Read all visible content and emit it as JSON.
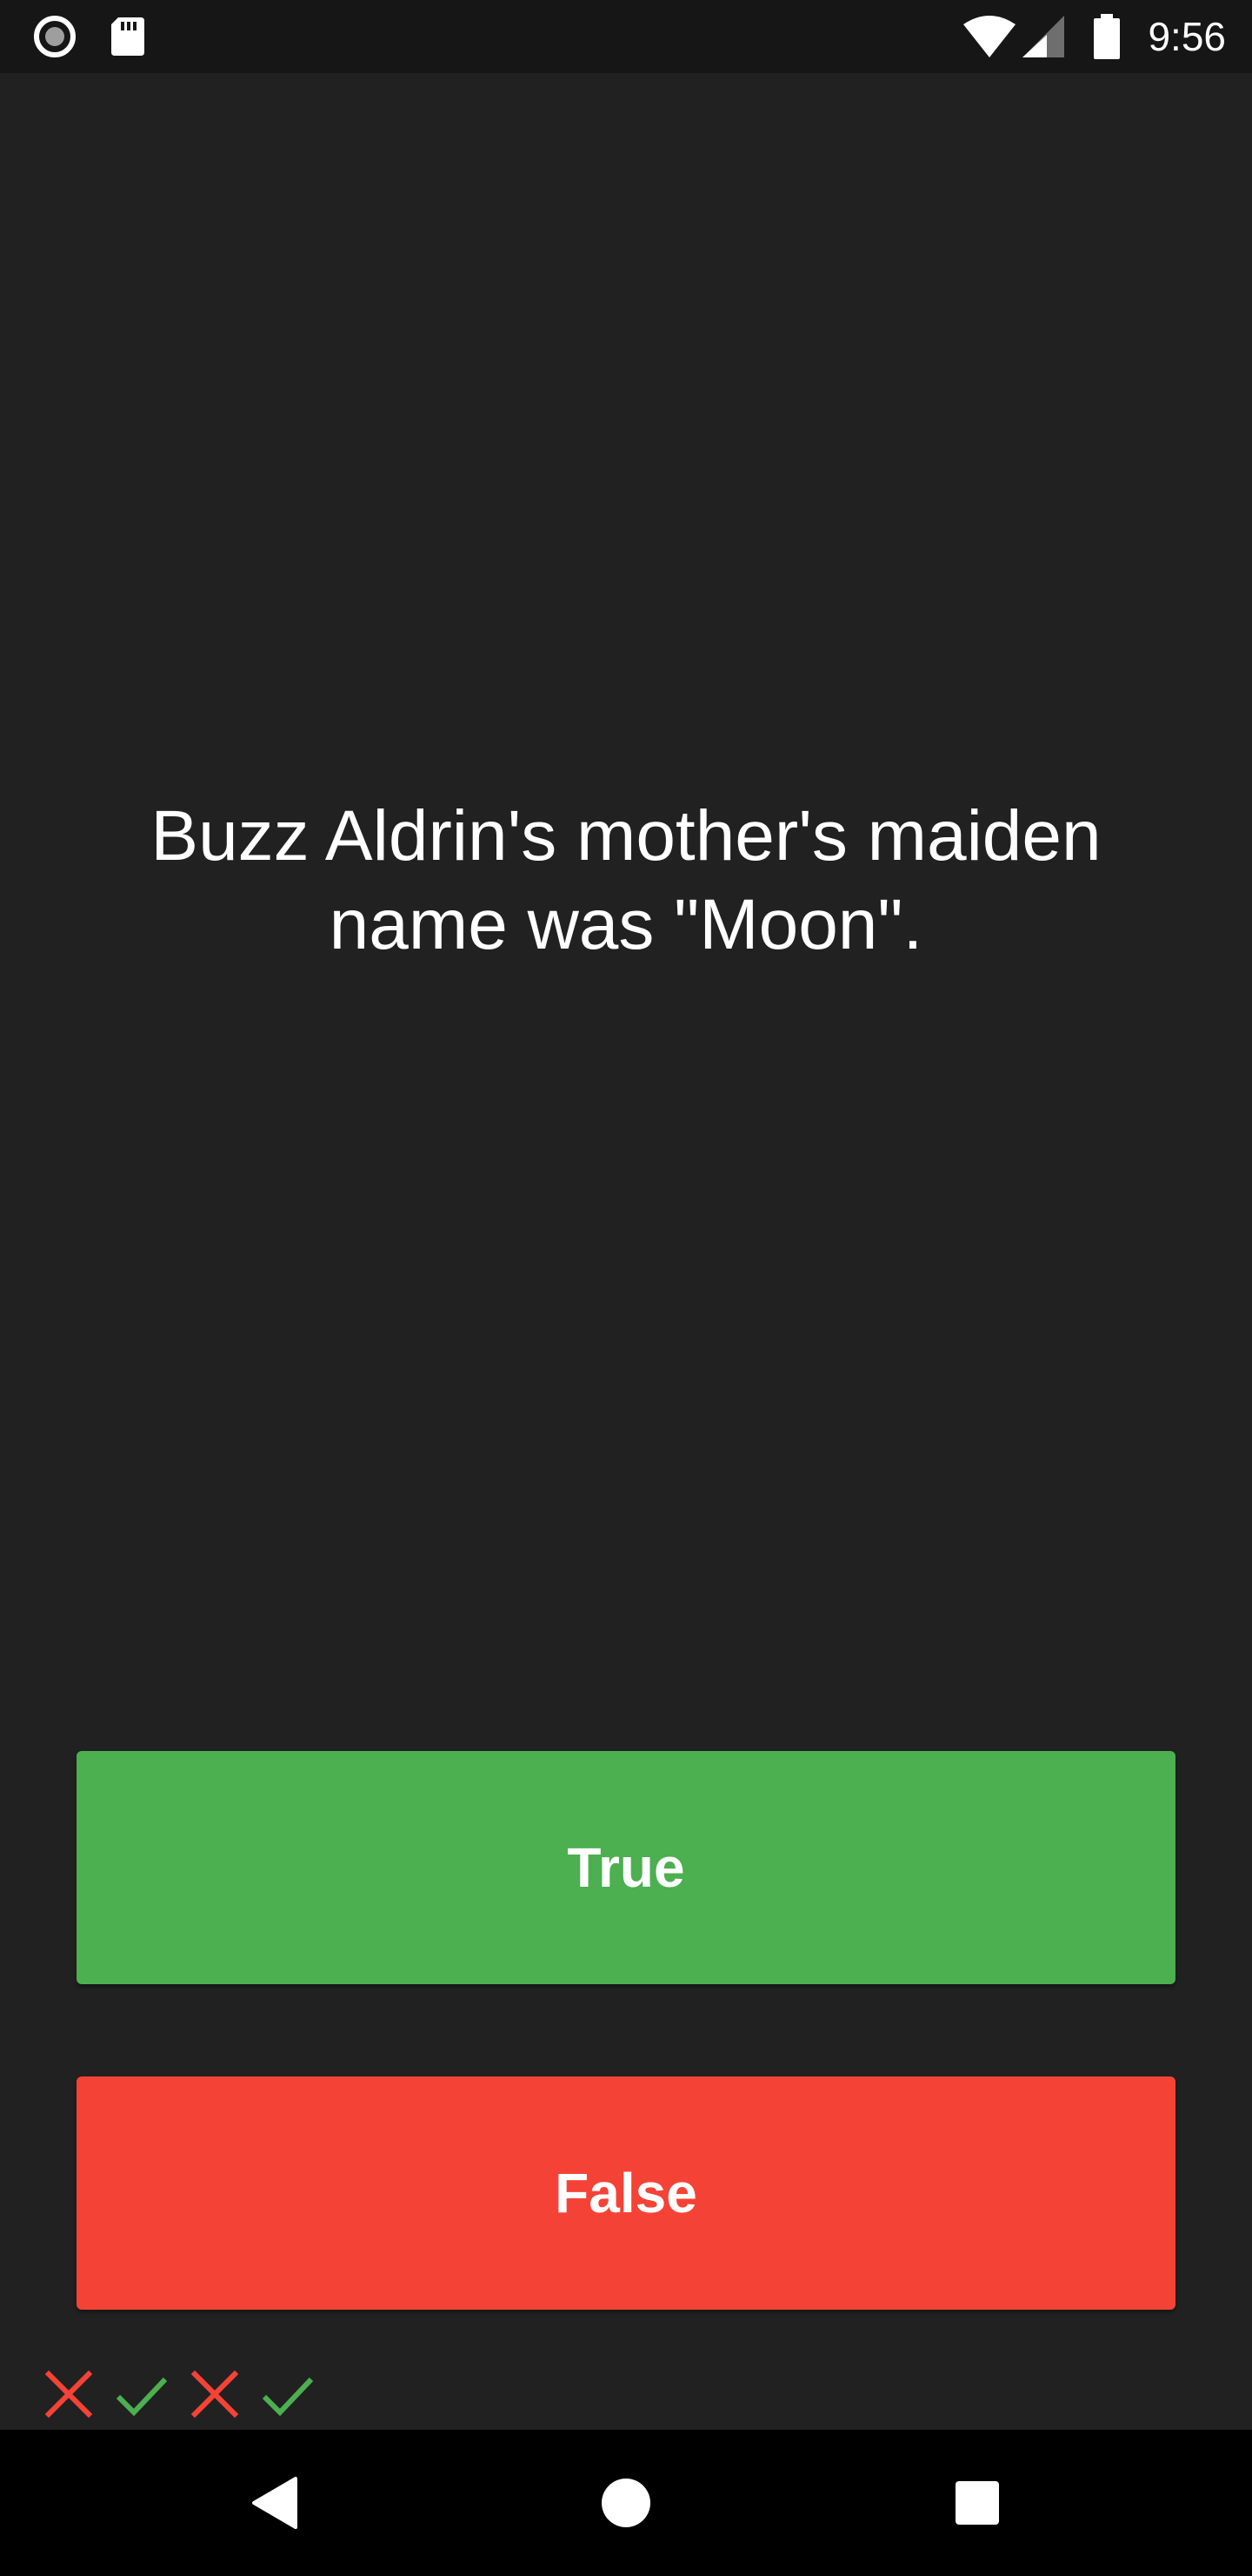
{
  "status_bar": {
    "time": "9:56",
    "left_icons": [
      "record-icon",
      "sd-card-icon"
    ],
    "right_icons": [
      "wifi-icon",
      "cell-signal-icon",
      "battery-icon"
    ]
  },
  "question": {
    "text": "Buzz Aldrin's mother's maiden name was \"Moon\"."
  },
  "buttons": {
    "true_label": "True",
    "false_label": "False"
  },
  "history": [
    "wrong",
    "correct",
    "wrong",
    "correct"
  ],
  "colors": {
    "true": "#4caf50",
    "false": "#f44336",
    "background": "#212121"
  },
  "nav_bar": {
    "icons": [
      "back-icon",
      "home-icon",
      "recents-icon"
    ]
  }
}
